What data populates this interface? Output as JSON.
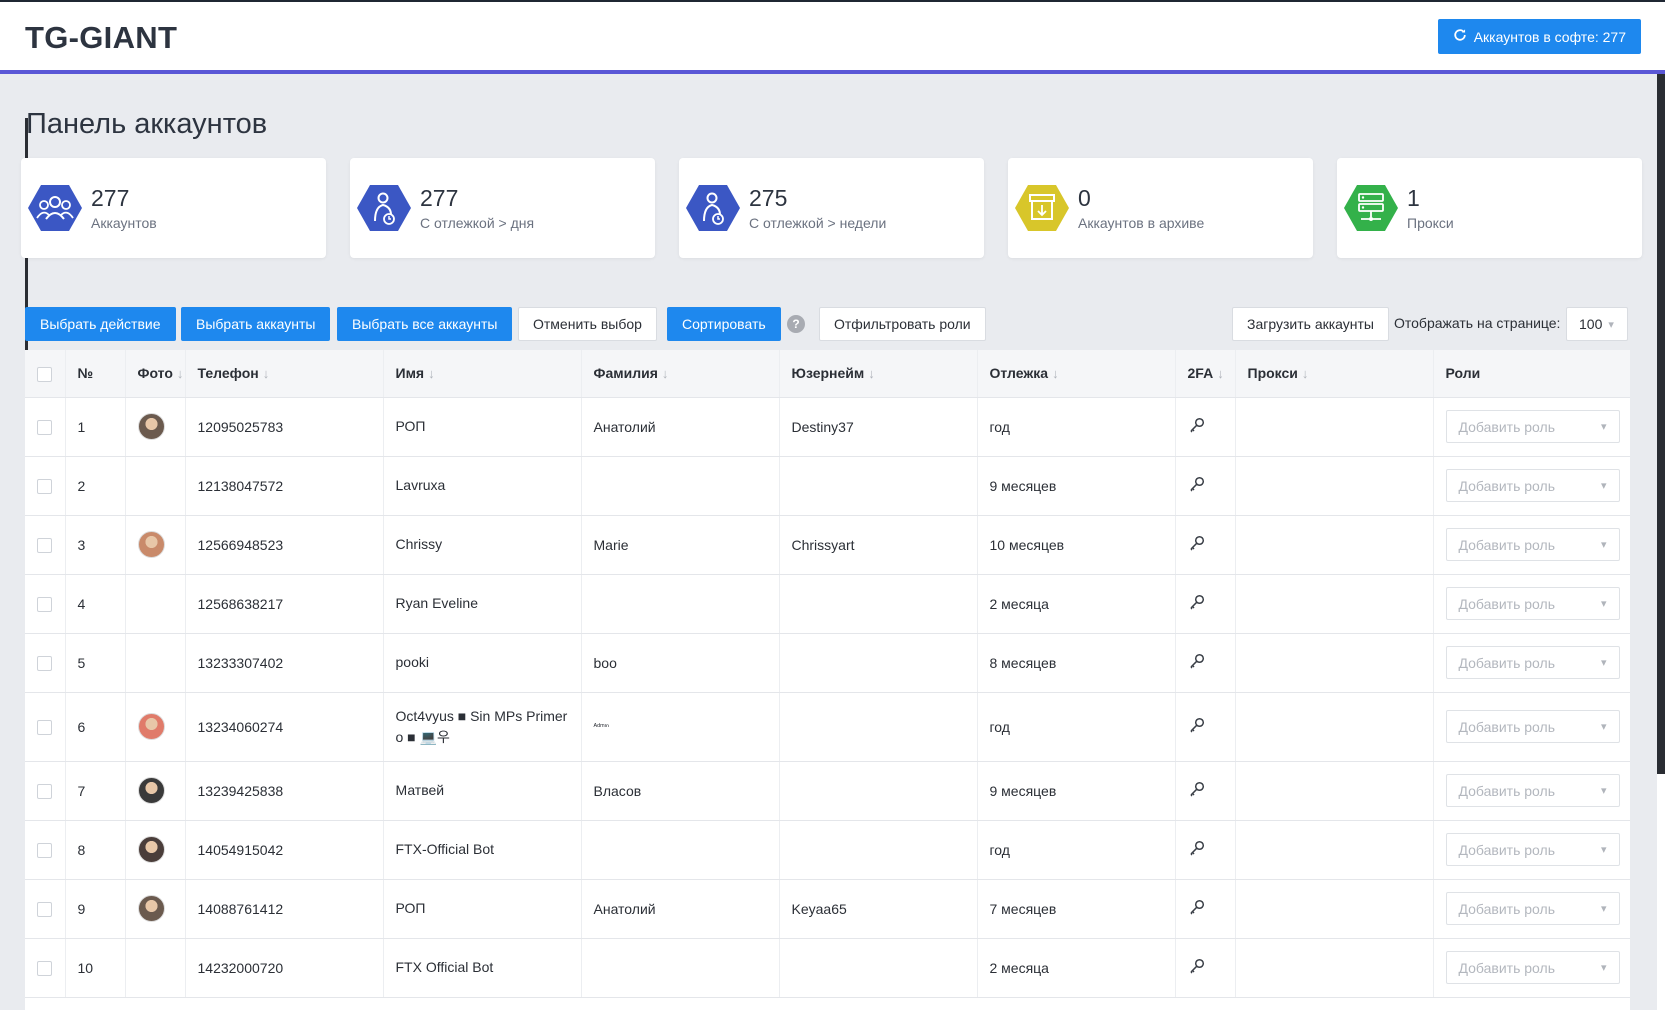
{
  "header": {
    "brand": "TG-GIANT",
    "refresh_button": "Аккаунтов в софте: 277"
  },
  "page": {
    "title": "Панель аккаунтов"
  },
  "stats": [
    {
      "value": "277",
      "label": "Аккаунтов",
      "icon": "users-icon",
      "color": "#3b57c4"
    },
    {
      "value": "277",
      "label": "С отлежкой > дня",
      "icon": "person-clock-icon",
      "color": "#3b57c4"
    },
    {
      "value": "275",
      "label": "С отлежкой > недели",
      "icon": "person-clock-icon",
      "color": "#3b57c4"
    },
    {
      "value": "0",
      "label": "Аккаунтов в архиве",
      "icon": "archive-icon",
      "color": "#d8c62a"
    },
    {
      "value": "1",
      "label": "Прокси",
      "icon": "server-icon",
      "color": "#33b14a"
    }
  ],
  "toolbar": {
    "choose_action": "Выбрать действие",
    "choose_accounts": "Выбрать аккаунты",
    "choose_all": "Выбрать все аккаунты",
    "cancel_selection": "Отменить выбор",
    "sort": "Сортировать",
    "help": "?",
    "filter_roles": "Отфильтровать роли",
    "load_accounts": "Загрузить аккаунты",
    "per_page_label": "Отображать на странице:",
    "per_page_value": "100"
  },
  "table": {
    "columns": {
      "num": "№",
      "photo": "Фото",
      "phone": "Телефон",
      "name": "Имя",
      "surname": "Фамилия",
      "username": "Юзернейм",
      "age": "Отлежка",
      "twofa": "2FA",
      "proxy": "Прокси",
      "roles": "Роли"
    },
    "role_placeholder": "Добавить роль",
    "rows": [
      {
        "num": "1",
        "photo": true,
        "phone": "12095025783",
        "name": "РОП",
        "surname": "Анатолий",
        "username": "Destiny37",
        "age": "год"
      },
      {
        "num": "2",
        "photo": false,
        "phone": "12138047572",
        "name": "Lavruxa",
        "surname": "",
        "username": "",
        "age": "9 месяцев"
      },
      {
        "num": "3",
        "photo": true,
        "phone": "12566948523",
        "name": "Chrissy",
        "surname": "Marie",
        "username": "Chrissyart",
        "age": "10 месяцев"
      },
      {
        "num": "4",
        "photo": false,
        "phone": "12568638217",
        "name": "Ryan Eveline",
        "surname": "",
        "username": "",
        "age": "2 месяца"
      },
      {
        "num": "5",
        "photo": false,
        "phone": "13233307402",
        "name": "pooki",
        "surname": "boo",
        "username": "",
        "age": "8 месяцев"
      },
      {
        "num": "6",
        "photo": true,
        "phone": "13234060274",
        "name": "Oct4vyus ■ Sin MPs Primer o ■ 💻우",
        "surname": "ᴬᵈᵐᶦⁿ",
        "username": "",
        "age": "год"
      },
      {
        "num": "7",
        "photo": true,
        "phone": "13239425838",
        "name": "Матвей",
        "surname": "Власов",
        "username": "",
        "age": "9 месяцев"
      },
      {
        "num": "8",
        "photo": true,
        "phone": "14054915042",
        "name": "FTX-Official Bot",
        "surname": "",
        "username": "",
        "age": "год"
      },
      {
        "num": "9",
        "photo": true,
        "phone": "14088761412",
        "name": "РОП",
        "surname": "Анатолий",
        "username": "Keyaa65",
        "age": "7 месяцев"
      },
      {
        "num": "10",
        "photo": false,
        "phone": "14232000720",
        "name": "FTX Official Bot",
        "surname": "",
        "username": "",
        "age": "2 месяца"
      }
    ]
  }
}
